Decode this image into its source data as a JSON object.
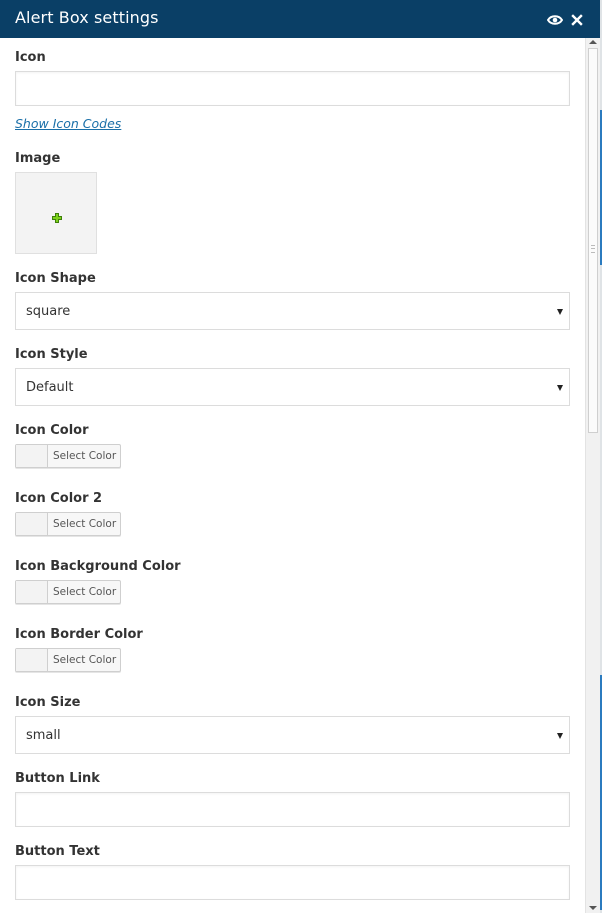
{
  "header": {
    "title": "Alert Box settings",
    "preview_icon": "eye-icon",
    "close_icon": "close-icon",
    "color": "#0a3f66"
  },
  "fields": {
    "icon": {
      "label": "Icon",
      "value": ""
    },
    "show_icon_codes": "Show Icon Codes",
    "image": {
      "label": "Image",
      "add_icon": "plus-icon"
    },
    "icon_shape": {
      "label": "Icon Shape",
      "value": "square"
    },
    "icon_style": {
      "label": "Icon Style",
      "value": "Default"
    },
    "icon_color": {
      "label": "Icon Color",
      "button": "Select Color"
    },
    "icon_color_2": {
      "label": "Icon Color 2",
      "button": "Select Color"
    },
    "icon_bg_color": {
      "label": "Icon Background Color",
      "button": "Select Color"
    },
    "icon_border_color": {
      "label": "Icon Border Color",
      "button": "Select Color"
    },
    "icon_size": {
      "label": "Icon Size",
      "value": "small"
    },
    "button_link": {
      "label": "Button Link",
      "value": ""
    },
    "button_text": {
      "label": "Button Text",
      "value": ""
    }
  }
}
